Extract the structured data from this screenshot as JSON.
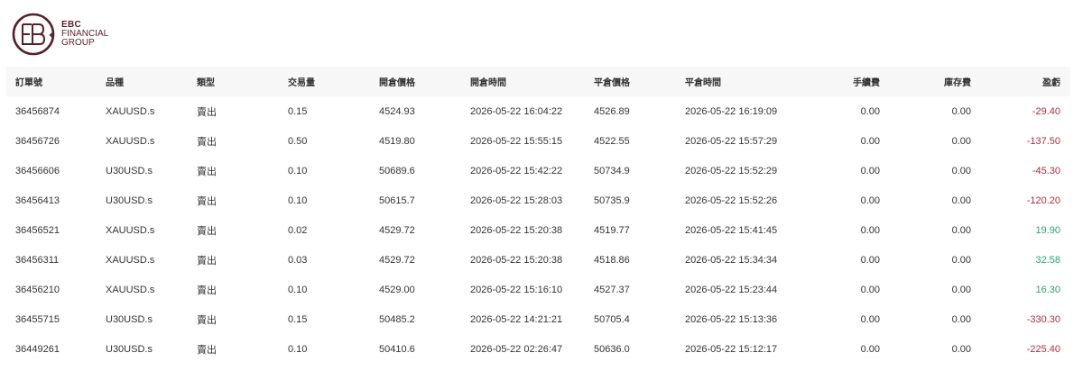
{
  "logo": {
    "line1": "EBC",
    "line2": "FINANCIAL",
    "line3": "GROUP",
    "color": "#5a1e2c"
  },
  "table": {
    "headers": {
      "order_no": "訂單號",
      "symbol": "品種",
      "type": "類型",
      "volume": "交易量",
      "open_price": "開倉價格",
      "open_time": "開倉時間",
      "close_price": "平倉價格",
      "close_time": "平倉時間",
      "commission": "手續費",
      "swap": "庫存費",
      "profit": "盈虧"
    },
    "rows": [
      {
        "order_no": "36456874",
        "symbol": "XAUUSD.s",
        "type": "賣出",
        "volume": "0.15",
        "open_price": "4524.93",
        "open_time": "2026-05-22 16:04:22",
        "close_price": "4526.89",
        "close_time": "2026-05-22 16:19:09",
        "commission": "0.00",
        "swap": "0.00",
        "profit": "-29.40",
        "profit_sign": "neg"
      },
      {
        "order_no": "36456726",
        "symbol": "XAUUSD.s",
        "type": "賣出",
        "volume": "0.50",
        "open_price": "4519.80",
        "open_time": "2026-05-22 15:55:15",
        "close_price": "4522.55",
        "close_time": "2026-05-22 15:57:29",
        "commission": "0.00",
        "swap": "0.00",
        "profit": "-137.50",
        "profit_sign": "neg"
      },
      {
        "order_no": "36456606",
        "symbol": "U30USD.s",
        "type": "賣出",
        "volume": "0.10",
        "open_price": "50689.6",
        "open_time": "2026-05-22 15:42:22",
        "close_price": "50734.9",
        "close_time": "2026-05-22 15:52:29",
        "commission": "0.00",
        "swap": "0.00",
        "profit": "-45.30",
        "profit_sign": "neg"
      },
      {
        "order_no": "36456413",
        "symbol": "U30USD.s",
        "type": "賣出",
        "volume": "0.10",
        "open_price": "50615.7",
        "open_time": "2026-05-22 15:28:03",
        "close_price": "50735.9",
        "close_time": "2026-05-22 15:52:26",
        "commission": "0.00",
        "swap": "0.00",
        "profit": "-120.20",
        "profit_sign": "neg"
      },
      {
        "order_no": "36456521",
        "symbol": "XAUUSD.s",
        "type": "賣出",
        "volume": "0.02",
        "open_price": "4529.72",
        "open_time": "2026-05-22 15:20:38",
        "close_price": "4519.77",
        "close_time": "2026-05-22 15:41:45",
        "commission": "0.00",
        "swap": "0.00",
        "profit": "19.90",
        "profit_sign": "pos"
      },
      {
        "order_no": "36456311",
        "symbol": "XAUUSD.s",
        "type": "賣出",
        "volume": "0.03",
        "open_price": "4529.72",
        "open_time": "2026-05-22 15:20:38",
        "close_price": "4518.86",
        "close_time": "2026-05-22 15:34:34",
        "commission": "0.00",
        "swap": "0.00",
        "profit": "32.58",
        "profit_sign": "pos"
      },
      {
        "order_no": "36456210",
        "symbol": "XAUUSD.s",
        "type": "賣出",
        "volume": "0.10",
        "open_price": "4529.00",
        "open_time": "2026-05-22 15:16:10",
        "close_price": "4527.37",
        "close_time": "2026-05-22 15:23:44",
        "commission": "0.00",
        "swap": "0.00",
        "profit": "16.30",
        "profit_sign": "pos"
      },
      {
        "order_no": "36455715",
        "symbol": "U30USD.s",
        "type": "賣出",
        "volume": "0.15",
        "open_price": "50485.2",
        "open_time": "2026-05-22 14:21:21",
        "close_price": "50705.4",
        "close_time": "2026-05-22 15:13:36",
        "commission": "0.00",
        "swap": "0.00",
        "profit": "-330.30",
        "profit_sign": "neg"
      },
      {
        "order_no": "36449261",
        "symbol": "U30USD.s",
        "type": "賣出",
        "volume": "0.10",
        "open_price": "50410.6",
        "open_time": "2026-05-22 02:26:47",
        "close_price": "50636.0",
        "close_time": "2026-05-22 15:12:17",
        "commission": "0.00",
        "swap": "0.00",
        "profit": "-225.40",
        "profit_sign": "neg"
      }
    ]
  },
  "colors": {
    "loss": "#a8303f",
    "gain": "#2ea36a",
    "header_bg": "#f7f7f8"
  }
}
